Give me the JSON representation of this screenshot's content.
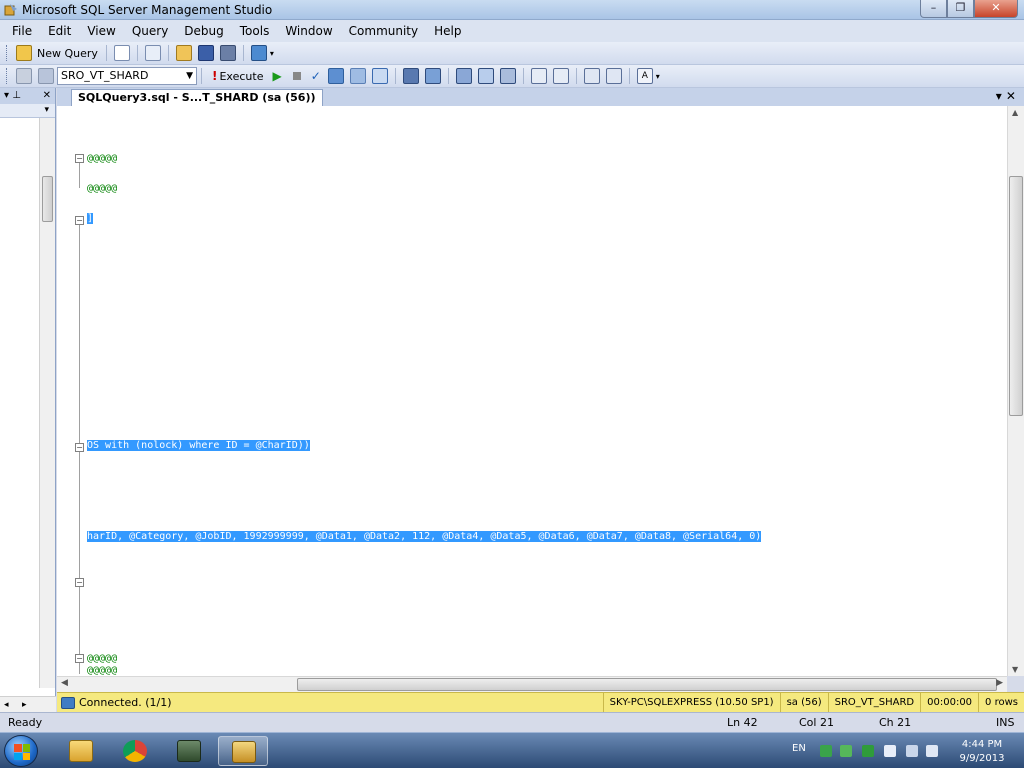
{
  "window": {
    "title": "Microsoft SQL Server Management Studio"
  },
  "menu": [
    "File",
    "Edit",
    "View",
    "Query",
    "Debug",
    "Tools",
    "Window",
    "Community",
    "Help"
  ],
  "toolbar": {
    "new_query_label": "New Query",
    "database": "SRO_VT_SHARD",
    "execute_label": "Execute"
  },
  "document_tab": {
    "label": "SQLQuery3.sql - S...T_SHARD (sa (56))"
  },
  "editor": {
    "lines": [
      {
        "text": "@@@@@",
        "style": "green"
      },
      {
        "text": "@@@@@",
        "style": "green"
      },
      {
        "text": "]",
        "style": "selected"
      },
      {
        "text": "OS with (nolock) where ID = @CharID))",
        "style": "selected"
      },
      {
        "text": "harID, @Category, @JobID, 1992999999, @Data1, @Data2, 112, @Data4, @Data5, @Data6, @Data7, @Data8, @Serial64, 0)",
        "style": "selected"
      },
      {
        "text": "@@@@@",
        "style": "green"
      },
      {
        "text": "@@@@@",
        "style": "green"
      }
    ]
  },
  "query_status": {
    "connection": "Connected. (1/1)",
    "server": "SKY-PC\\SQLEXPRESS (10.50 SP1)",
    "user": "sa (56)",
    "database": "SRO_VT_SHARD",
    "elapsed": "00:00:00",
    "rows": "0 rows"
  },
  "statusbar": {
    "state": "Ready",
    "ln": "Ln 42",
    "col": "Col 21",
    "ch": "Ch 21",
    "mode": "INS"
  },
  "taskbar": {
    "lang": "EN",
    "time": "4:44 PM",
    "date": "9/9/2013"
  },
  "colors": {
    "selection": "#3399ff",
    "comment_green": "#008000",
    "status_yellow": "#f5e97f"
  }
}
